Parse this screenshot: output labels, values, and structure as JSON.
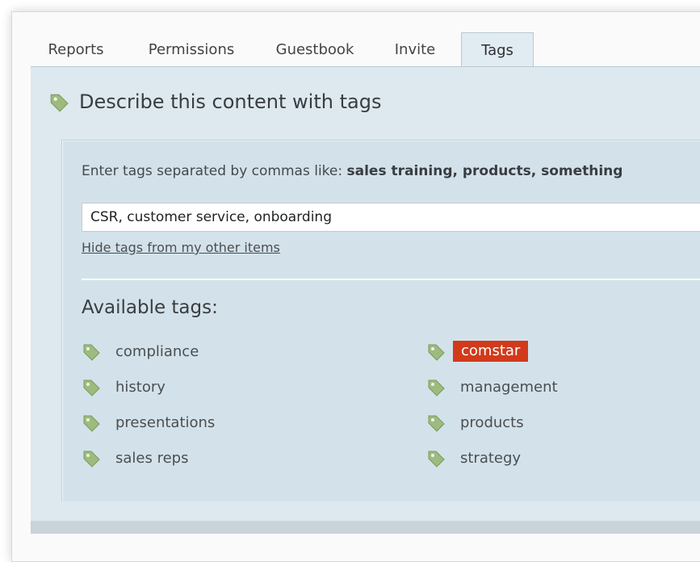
{
  "tabs": [
    {
      "label": "Reports"
    },
    {
      "label": "Permissions"
    },
    {
      "label": "Guestbook"
    },
    {
      "label": "Invite"
    },
    {
      "label": "Tags",
      "active": true
    }
  ],
  "header": {
    "icon": "tag-icon",
    "title": "Describe this content with tags"
  },
  "entry": {
    "hint_prefix": "Enter tags separated by commas like: ",
    "hint_examples": "sales training, products, something",
    "input_value": "CSR, customer service, onboarding",
    "hide_link": "Hide tags from my other items"
  },
  "available": {
    "title": "Available tags:",
    "left": [
      "compliance",
      "history",
      "presentations",
      "sales reps"
    ],
    "right": [
      "comstar",
      "management",
      "products",
      "strategy"
    ],
    "selected": "comstar"
  },
  "colors": {
    "panel": "#dde9ef",
    "inner_panel": "#d3e2ea",
    "selected_tag": "#d13a1a",
    "tag_icon": "#8bb36b"
  }
}
